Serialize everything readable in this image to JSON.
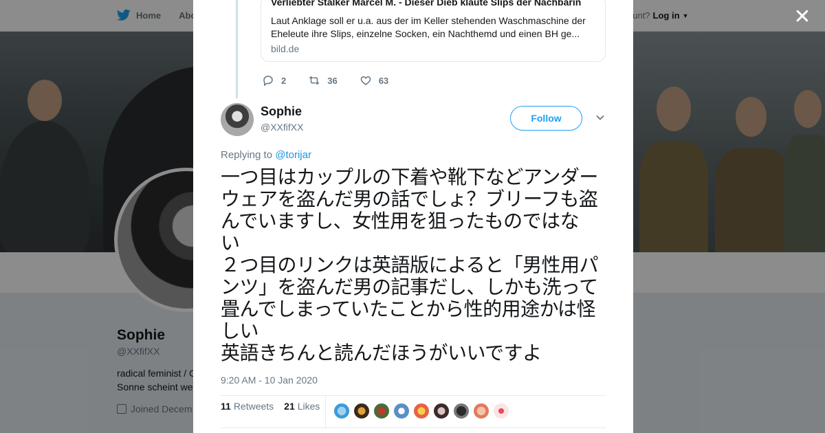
{
  "topbar": {
    "home_label": "Home",
    "about_label": "Abo",
    "account_text": "ccount?",
    "login_label": "Log in"
  },
  "profile": {
    "name": "Sophie",
    "handle": "@XXfifXX",
    "bio_line1": "radical feminist / C",
    "bio_line2": "Sonne scheint we",
    "joined": "Joined Decem"
  },
  "close_icon": "close-icon",
  "parent_tweet": {
    "card_title": "Verliebter Stalker Marcel M. - Dieser Dieb klaute Slips der Nachbarin",
    "card_description": "Laut Anklage soll er u.a. aus der im Keller stehenden Waschmaschine der Eheleute ihre Slips, einzelne Socken, ein Nachthemd und einen BH ge...",
    "card_domain": "bild.de",
    "replies": "2",
    "retweets": "36",
    "likes": "63"
  },
  "tweet": {
    "name": "Sophie",
    "handle": "@XXfifXX",
    "follow_label": "Follow",
    "replying_prefix": "Replying to",
    "replying_to": "@torijar",
    "text_lines": [
      "一つ目はカップルの下着や靴下などアンダー",
      "ウェアを盗んだ男の話でしょ？ブリーフも盗",
      "んでいますし、女性用を狙ったものではな",
      "い",
      "２つ目のリンクは英語版によると「男性用パ",
      "ンツ」を盗んだ男の記事だし、しかも洗って",
      "畳んでしまっていたことから性的用途かは怪",
      "しい",
      "英語きちんと読んだほうがいいですよ"
    ],
    "timestamp": "9:20 AM - 10 Jan 2020",
    "retweet_count": "11",
    "retweet_label": "Retweets",
    "like_count": "21",
    "like_label": "Likes"
  },
  "colors": {
    "accent": "#1da1f2",
    "text": "#14171a",
    "secondary": "#657786"
  }
}
